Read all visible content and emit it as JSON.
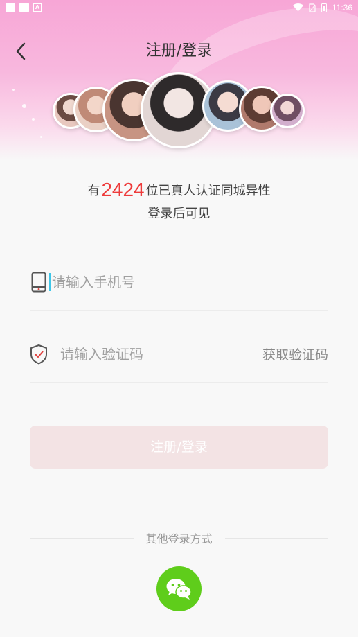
{
  "status_bar": {
    "time": "11:36",
    "left_badge": "A"
  },
  "header": {
    "title": "注册/登录",
    "back_icon": "chevron-left-icon"
  },
  "avatars": [
    {
      "label": "avatar-1",
      "color": "#c9a89c"
    },
    {
      "label": "avatar-2",
      "color": "#d9b3a3"
    },
    {
      "label": "avatar-3",
      "color": "#b38a7a"
    },
    {
      "label": "avatar-4",
      "color": "#e2d6d4"
    },
    {
      "label": "avatar-5",
      "color": "#9fb7cc"
    },
    {
      "label": "avatar-6",
      "color": "#b07a6c"
    },
    {
      "label": "avatar-7",
      "color": "#c7a5c4"
    }
  ],
  "promo": {
    "prefix": "有",
    "count": "2424",
    "suffix": "位已真人认证同城异性",
    "sub": "登录后可见"
  },
  "phone_field": {
    "placeholder": "请输入手机号",
    "icon": "phone-icon"
  },
  "code_field": {
    "placeholder": "请输入验证码",
    "icon": "shield-check-icon",
    "get_code_label": "获取验证码"
  },
  "login_button": {
    "label": "注册/登录",
    "bg": "#f3e3e4"
  },
  "other_login": {
    "label": "其他登录方式",
    "wechat_icon": "wechat-icon",
    "wechat_color": "#5fcd1b"
  },
  "colors": {
    "accent": "#ee3b3b",
    "header_pink": "#f7a6d6",
    "caret": "#3ec6e8"
  }
}
